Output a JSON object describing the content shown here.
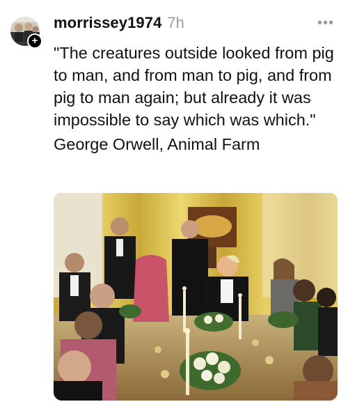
{
  "post": {
    "author": {
      "username": "morrissey1974",
      "avatar_icon": "avatar-photo",
      "follow_badge": "+"
    },
    "timestamp": "7h",
    "more_icon": "ellipsis-icon",
    "quote": "\"The creatures outside looked from pig to man, and from man to pig, and from pig to man again; but already it was impossible to say which was which.\"",
    "attribution": "George Orwell, Animal Farm",
    "image": {
      "description": "state-dinner-photo"
    }
  },
  "colors": {
    "text": "#111111",
    "muted": "#9a9a9a",
    "background": "#ffffff"
  }
}
